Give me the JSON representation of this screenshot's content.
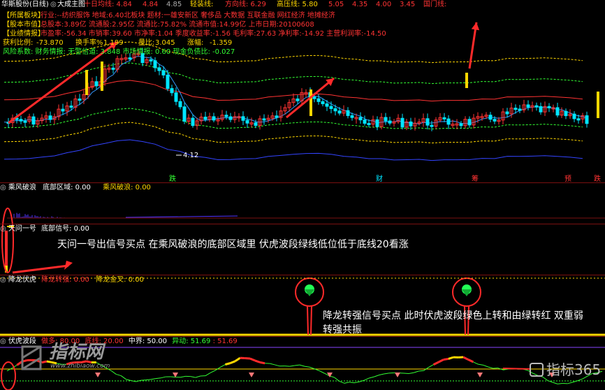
{
  "header": {
    "stock_name": "华斯股份(日线)",
    "main_indicator": "大成主图",
    "items": [
      {
        "label": "十日均线:",
        "value": "4.84",
        "color": "#ff3333"
      },
      {
        "label": "",
        "value": "4.84",
        "color": "#ff3333"
      },
      {
        "label": "",
        "value": "4.85",
        "color": "#aaaaaa"
      },
      {
        "label": "轻装线:",
        "value": "",
        "color": "#ffd700"
      },
      {
        "label": "方向线:",
        "value": "6.29",
        "color": "#ff3333"
      },
      {
        "label": "高压线:",
        "value": "5.80",
        "color": "#ffd700"
      },
      {
        "label": "",
        "value": "5.05",
        "color": "#ff3333"
      },
      {
        "label": "",
        "value": "4.35",
        "color": "#ff3333"
      },
      {
        "label": "",
        "value": "4.00",
        "color": "#ff3333"
      },
      {
        "label": "",
        "value": "3.45",
        "color": "#ff3333"
      },
      {
        "label": "国门线:",
        "value": "",
        "color": "#ff3333"
      }
    ]
  },
  "info_rows": [
    {
      "tag": "【所属板块】",
      "text": "行业:--纺织服饰   地域:6.40北板块   题材:一雄安新区 奢侈品 大数据 互联金融 网红经济 地摊经济"
    },
    {
      "tag": "【股本市值】",
      "text": "总股本:3.89亿   流通股:2.95亿   流通比:75.82%   流通市值:14.99亿   上市日期:20100608"
    },
    {
      "tag": "【业绩情报】",
      "text": "市盈率:-56.34   市销率:39.60   市净率:1.04   季度收益率:-1.56   毛利率:27.63   净利率:-14.92   主营利润率:-14.50"
    }
  ],
  "stats_row": {
    "profit_label": "获利比例:",
    "profit_value": "-73.870",
    "turnover_label": "换手率%",
    "turnover_value": "1.199",
    "volratio_label": "量比:",
    "volratio_value": "3.045",
    "change_label": "涨幅:",
    "change_value": "-1.359"
  },
  "risk_row": "风险系数: 财务情报: 无警信道: 3.848 市场情报: 0.60 现金负债比: -0.027",
  "low_label": "4.12",
  "bottom_markers": [
    "跌",
    "财",
    "筹",
    "预",
    "跌"
  ],
  "panes": {
    "p1": {
      "name": "乘风破浪",
      "a": "底部区域: 0.00",
      "b": "乘风破浪: 0.00"
    },
    "p2": {
      "name": "天问一号",
      "a": "底部信号: 0.00"
    },
    "p3": {
      "name": "降龙伏虎",
      "a": "降龙转强: 0.00",
      "b": "降龙金叉: 0.00"
    },
    "p4": {
      "name": "伏虎波段",
      "a": "做多: 80.00",
      "b": "底线: 20.00",
      "c": "中界: 50.00",
      "d": "异动: 51.69",
      "e": ": 51.69"
    }
  },
  "annotations": {
    "tianwen": "天问一号出信号买点 在乘风破浪的底部区域里 伏虎波段绿线低位低于底线20看涨",
    "xianglong_1": "降龙转强信号买点 此时伏虎波段绿色上转和由绿转红 双重弱",
    "xianglong_2": "转强共振"
  },
  "watermark": {
    "left": "指标网",
    "left_url": "www.zhibiaow.com",
    "right": "指标365"
  },
  "colors": {
    "up": "#ff3333",
    "down": "#00e5ff",
    "gold": "#ffd700",
    "grid": "#7a1010"
  }
}
